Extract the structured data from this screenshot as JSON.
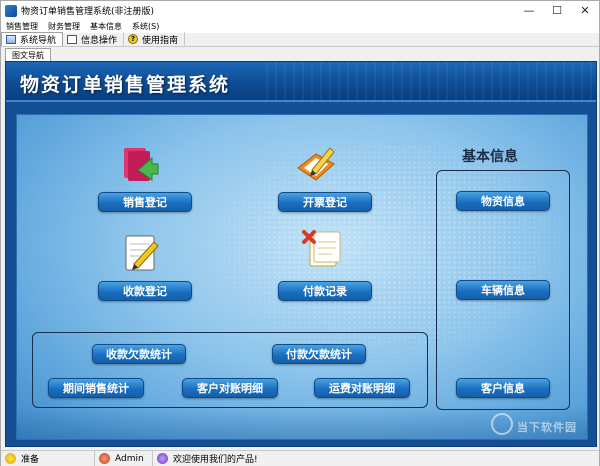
{
  "window": {
    "title": "物资订单销售管理系统(非注册版)",
    "controls": {
      "minimize": "—",
      "maximize": "☐",
      "close": "✕"
    }
  },
  "menu": [
    "销售管理",
    "财务管理",
    "基本信息",
    "系统(S)"
  ],
  "toolbar": {
    "tabs": [
      {
        "label": "系统导航",
        "icon": "nav-icon",
        "active": true
      },
      {
        "label": "信息操作",
        "icon": "info-icon",
        "active": false
      },
      {
        "label": "使用指南",
        "icon": "help-icon",
        "active": false
      }
    ],
    "help_glyph": "?"
  },
  "subtab": {
    "label": "图文导航"
  },
  "banner": {
    "title": "物资订单销售管理系统"
  },
  "nav": {
    "sales_register": "销售登记",
    "invoice_register": "开票登记",
    "receipt_register": "收款登记",
    "payment_record": "付款记录",
    "receivable_stats": "收款欠款统计",
    "payable_stats": "付款欠款统计",
    "period_sales_stats": "期间销售统计",
    "customer_statement": "客户对账明细",
    "freight_statement": "运费对账明细"
  },
  "basic_info": {
    "title": "基本信息",
    "material": "物资信息",
    "vehicle": "车辆信息",
    "customer": "客户信息"
  },
  "status": {
    "ready": "准备",
    "user": "Admin",
    "welcome": "欢迎使用我们的产品!"
  },
  "watermark": "当下软件园",
  "colors": {
    "banner": "#154f93",
    "button": "#1a6fc0",
    "panel": "#8ec5ec"
  }
}
